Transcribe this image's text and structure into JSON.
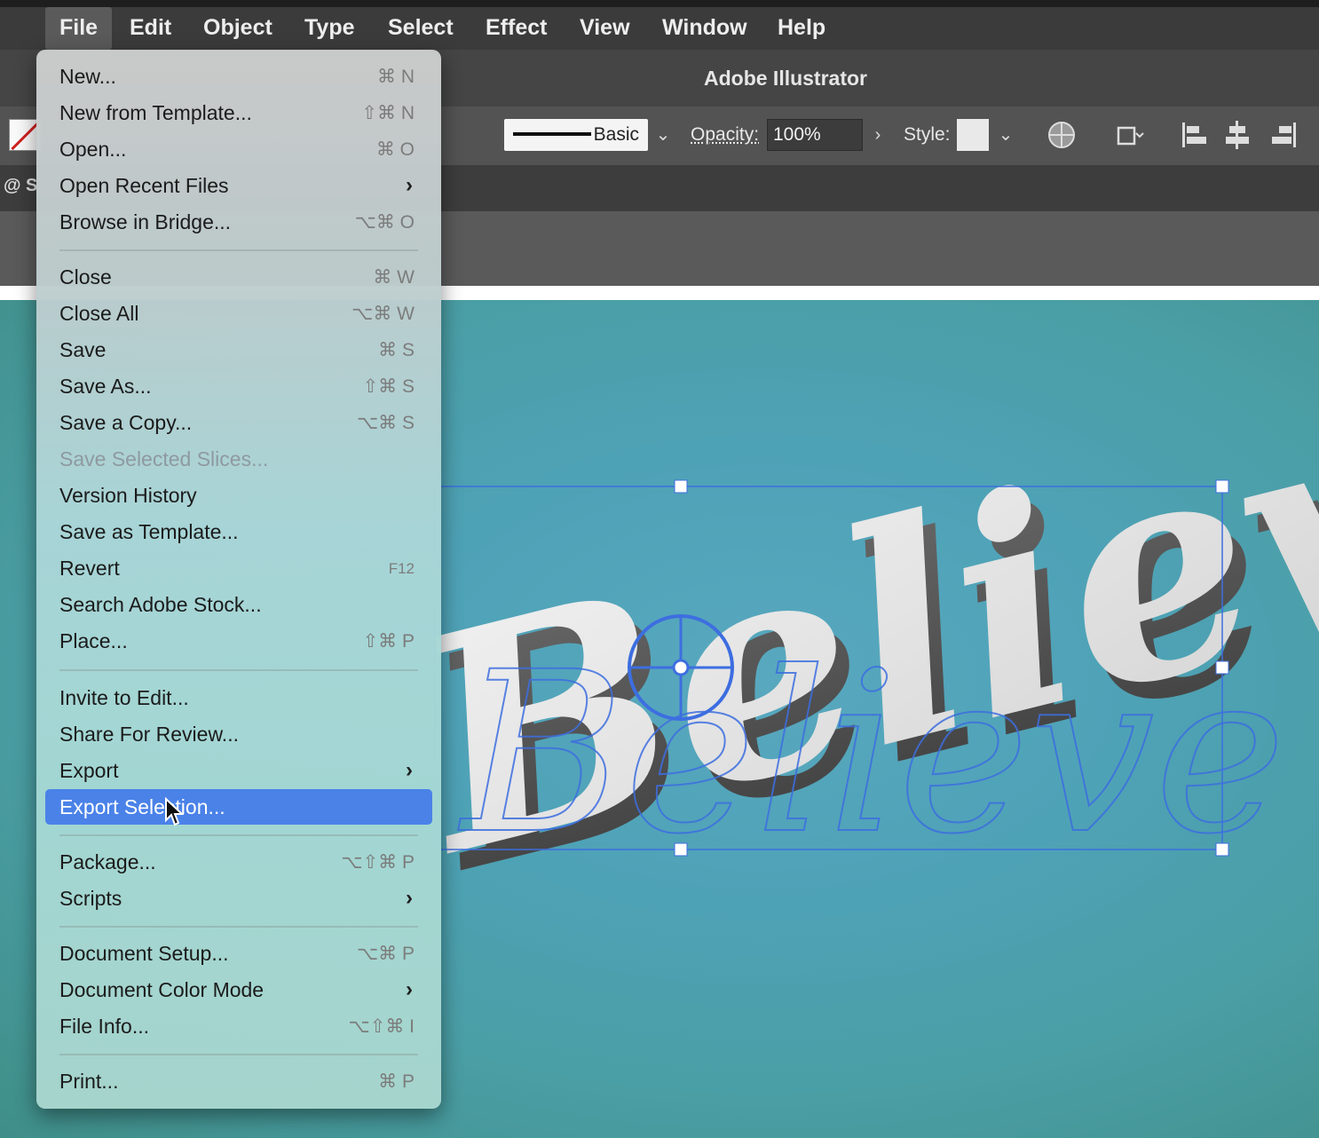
{
  "menubar": {
    "items": [
      "File",
      "Edit",
      "Object",
      "Type",
      "Select",
      "Effect",
      "View",
      "Window",
      "Help"
    ],
    "active": "File"
  },
  "window": {
    "title": "Adobe Illustrator"
  },
  "controlbar": {
    "stroke_profile": "Basic",
    "opacity_label": "Opacity:",
    "opacity_value": "100%",
    "style_label": "Style:"
  },
  "document_tab": "@ S",
  "artwork": {
    "text": "Believe"
  },
  "file_menu": {
    "items": [
      {
        "label": "New...",
        "shortcut": "⌘ N"
      },
      {
        "label": "New from Template...",
        "shortcut": "⇧⌘ N"
      },
      {
        "label": "Open...",
        "shortcut": "⌘ O"
      },
      {
        "label": "Open Recent Files",
        "submenu": true
      },
      {
        "label": "Browse in Bridge...",
        "shortcut": "⌥⌘ O"
      },
      {
        "label": "Close",
        "shortcut": "⌘ W"
      },
      {
        "label": "Close All",
        "shortcut": "⌥⌘ W"
      },
      {
        "label": "Save",
        "shortcut": "⌘ S"
      },
      {
        "label": "Save As...",
        "shortcut": "⇧⌘ S"
      },
      {
        "label": "Save a Copy...",
        "shortcut": "⌥⌘ S"
      },
      {
        "label": "Save Selected Slices...",
        "disabled": true
      },
      {
        "label": "Version History"
      },
      {
        "label": "Save as Template..."
      },
      {
        "label": "Revert",
        "shortcut": "F12"
      },
      {
        "label": "Search Adobe Stock..."
      },
      {
        "label": "Place...",
        "shortcut": "⇧⌘ P"
      },
      {
        "label": "Invite to Edit..."
      },
      {
        "label": "Share For Review..."
      },
      {
        "label": "Export",
        "submenu": true
      },
      {
        "label": "Export Selection...",
        "highlighted": true
      },
      {
        "label": "Package...",
        "shortcut": "⌥⇧⌘ P"
      },
      {
        "label": "Scripts",
        "submenu": true
      },
      {
        "label": "Document Setup...",
        "shortcut": "⌥⌘ P"
      },
      {
        "label": "Document Color Mode",
        "submenu": true
      },
      {
        "label": "File Info...",
        "shortcut": "⌥⇧⌘ I"
      },
      {
        "label": "Print...",
        "shortcut": "⌘ P"
      }
    ]
  },
  "colors": {
    "menu_highlight": "#4a82e8",
    "selection_blue": "#3d6ee0",
    "canvas_teal": "#4ea2b6"
  }
}
